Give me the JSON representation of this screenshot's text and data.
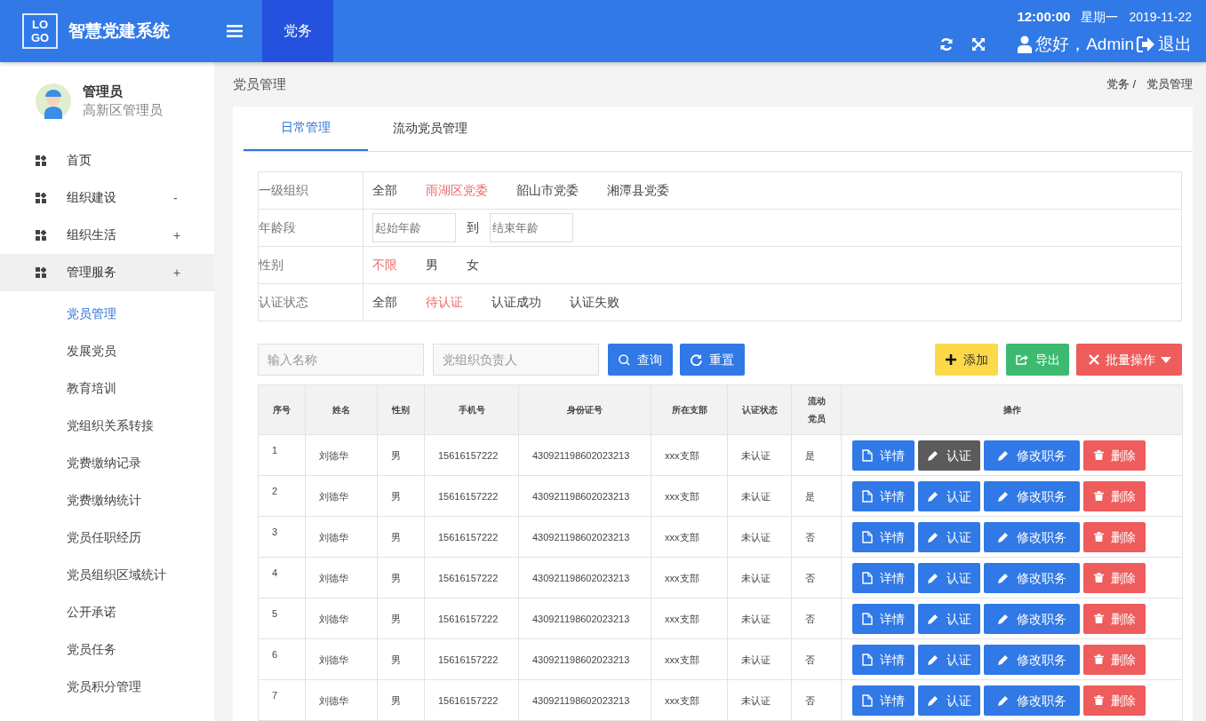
{
  "header": {
    "logo": [
      "LO",
      "GO"
    ],
    "title": "智慧党建系统",
    "nav": [
      {
        "label": "党务",
        "selected": true
      }
    ],
    "time": "12:00:00",
    "weekday": "星期一",
    "date": "2019-11-22",
    "greeting": "您好，Admin",
    "logout": "退出"
  },
  "sidebar": {
    "user": {
      "name": "管理员",
      "role": "高新区管理员"
    },
    "items": [
      {
        "label": "首页",
        "selected": false
      },
      {
        "label": "组织建设",
        "toggle": "-",
        "selected": false
      },
      {
        "label": "组织生活",
        "toggle": "+",
        "selected": false
      },
      {
        "label": "管理服务",
        "toggle": "+",
        "selected": true,
        "children": [
          {
            "label": "党员管理",
            "selected": true
          },
          {
            "label": "发展党员",
            "selected": false
          },
          {
            "label": "教育培训",
            "selected": false
          },
          {
            "label": "党组织关系转接",
            "selected": false
          },
          {
            "label": "党费缴纳记录",
            "selected": false
          },
          {
            "label": "党费缴纳统计",
            "selected": false
          },
          {
            "label": "党员任职经历",
            "selected": false
          },
          {
            "label": "党员组织区域统计",
            "selected": false
          },
          {
            "label": "公开承诺",
            "selected": false
          },
          {
            "label": "党员任务",
            "selected": false
          },
          {
            "label": "党员积分管理",
            "selected": false
          }
        ]
      }
    ]
  },
  "page": {
    "title": "党员管理",
    "breadcrumb": [
      "党务 /",
      "党员管理"
    ]
  },
  "tabs": [
    {
      "label": "日常管理",
      "selected": true
    },
    {
      "label": "流动党员管理",
      "selected": false
    }
  ],
  "filters": [
    {
      "kind": "options",
      "label": "一级组织",
      "options": [
        {
          "label": "全部",
          "selected": false
        },
        {
          "label": "雨湖区党委",
          "selected": true
        },
        {
          "label": "韶山市党委",
          "selected": false
        },
        {
          "label": "湘潭县党委",
          "selected": false
        }
      ]
    },
    {
      "kind": "range",
      "label": "年龄段",
      "from": {
        "placeholder": "起始年龄"
      },
      "to_label": "到",
      "to": {
        "placeholder": "结束年龄"
      }
    },
    {
      "kind": "options",
      "label": "性别",
      "options": [
        {
          "label": "不限",
          "selected": true
        },
        {
          "label": "男",
          "selected": false
        },
        {
          "label": "女",
          "selected": false
        }
      ]
    },
    {
      "kind": "options",
      "label": "认证状态",
      "options": [
        {
          "label": "全部",
          "selected": false
        },
        {
          "label": "待认证",
          "selected": true
        },
        {
          "label": "认证成功",
          "selected": false
        },
        {
          "label": "认证失败",
          "selected": false
        }
      ]
    }
  ],
  "search": {
    "name": {
      "placeholder": "输入名称"
    },
    "leader": {
      "placeholder": "党组织负责人"
    },
    "query": "查询",
    "reset": "重置"
  },
  "toolbar": [
    {
      "kind": "add",
      "label": "添加"
    },
    {
      "kind": "export",
      "label": "导出"
    },
    {
      "kind": "batch",
      "label": "批量操作"
    }
  ],
  "table": {
    "columns": [
      "序号",
      "姓名",
      "性别",
      "手机号",
      "身份证号",
      "所在支部",
      "认证状态",
      "流动党员",
      "操作"
    ],
    "rows": [
      {
        "cells": [
          "1",
          "刘德华",
          "男",
          "15616157222",
          "430921198602023213",
          "xxx支部",
          "未认证",
          "是"
        ],
        "actions": [
          {
            "kind": "detail",
            "label": "详情",
            "highlighted": false
          },
          {
            "kind": "verify",
            "label": "认证",
            "highlighted": true
          },
          {
            "kind": "edit",
            "label": "修改职务",
            "highlighted": false
          },
          {
            "kind": "delete",
            "label": "删除",
            "highlighted": false
          }
        ]
      },
      {
        "cells": [
          "2",
          "刘德华",
          "男",
          "15616157222",
          "430921198602023213",
          "xxx支部",
          "未认证",
          "是"
        ],
        "actions": [
          {
            "kind": "detail",
            "label": "详情",
            "highlighted": false
          },
          {
            "kind": "verify",
            "label": "认证",
            "highlighted": false
          },
          {
            "kind": "edit",
            "label": "修改职务",
            "highlighted": false
          },
          {
            "kind": "delete",
            "label": "删除",
            "highlighted": false
          }
        ]
      },
      {
        "cells": [
          "3",
          "刘德华",
          "男",
          "15616157222",
          "430921198602023213",
          "xxx支部",
          "未认证",
          "否"
        ],
        "actions": [
          {
            "kind": "detail",
            "label": "详情",
            "highlighted": false
          },
          {
            "kind": "verify",
            "label": "认证",
            "highlighted": false
          },
          {
            "kind": "edit",
            "label": "修改职务",
            "highlighted": false
          },
          {
            "kind": "delete",
            "label": "删除",
            "highlighted": false
          }
        ]
      },
      {
        "cells": [
          "4",
          "刘德华",
          "男",
          "15616157222",
          "430921198602023213",
          "xxx支部",
          "未认证",
          "否"
        ],
        "actions": [
          {
            "kind": "detail",
            "label": "详情",
            "highlighted": false
          },
          {
            "kind": "verify",
            "label": "认证",
            "highlighted": false
          },
          {
            "kind": "edit",
            "label": "修改职务",
            "highlighted": false
          },
          {
            "kind": "delete",
            "label": "删除",
            "highlighted": false
          }
        ]
      },
      {
        "cells": [
          "5",
          "刘德华",
          "男",
          "15616157222",
          "430921198602023213",
          "xxx支部",
          "未认证",
          "否"
        ],
        "actions": [
          {
            "kind": "detail",
            "label": "详情",
            "highlighted": false
          },
          {
            "kind": "verify",
            "label": "认证",
            "highlighted": false
          },
          {
            "kind": "edit",
            "label": "修改职务",
            "highlighted": false
          },
          {
            "kind": "delete",
            "label": "删除",
            "highlighted": false
          }
        ]
      },
      {
        "cells": [
          "6",
          "刘德华",
          "男",
          "15616157222",
          "430921198602023213",
          "xxx支部",
          "未认证",
          "否"
        ],
        "actions": [
          {
            "kind": "detail",
            "label": "详情",
            "highlighted": false
          },
          {
            "kind": "verify",
            "label": "认证",
            "highlighted": false
          },
          {
            "kind": "edit",
            "label": "修改职务",
            "highlighted": false
          },
          {
            "kind": "delete",
            "label": "删除",
            "highlighted": false
          }
        ]
      },
      {
        "cells": [
          "7",
          "刘德华",
          "男",
          "15616157222",
          "430921198602023213",
          "xxx支部",
          "未认证",
          "否"
        ],
        "actions": [
          {
            "kind": "detail",
            "label": "详情",
            "highlighted": false
          },
          {
            "kind": "verify",
            "label": "认证",
            "highlighted": false
          },
          {
            "kind": "edit",
            "label": "修改职务",
            "highlighted": false
          },
          {
            "kind": "delete",
            "label": "删除",
            "highlighted": false
          }
        ]
      }
    ]
  }
}
